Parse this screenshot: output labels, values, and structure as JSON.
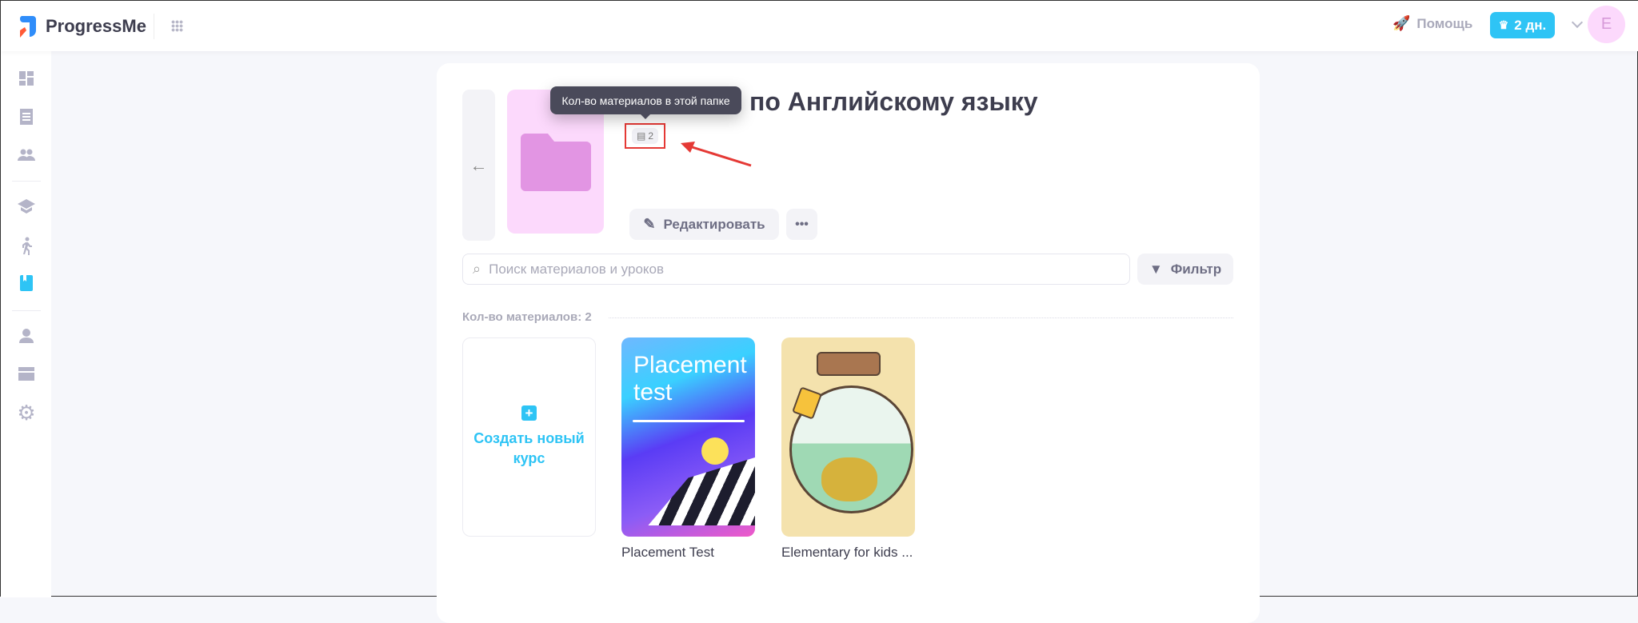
{
  "header": {
    "brand": "ProgressMe",
    "help_label": "Помощь",
    "trial_badge": "2 дн.",
    "avatar_initial": "E",
    "accent": "#2ec4f5"
  },
  "sidebar": {
    "items": [
      "dashboard",
      "materials",
      "groups",
      "courses",
      "activity",
      "library",
      "profile",
      "billing",
      "settings"
    ],
    "active": "library"
  },
  "folder": {
    "title_visible": "по Английскому языку",
    "materials_count": "2",
    "tooltip": "Кол-во материалов в этой папке",
    "edit_label": "Редактировать"
  },
  "search": {
    "placeholder": "Поиск материалов и уроков",
    "filter_label": "Фильтр"
  },
  "materials_count_label": "Кол-во материалов: 2",
  "create_course_label": "Создать новый курс",
  "courses": [
    {
      "title": "Placement Test",
      "cover_text": "Placement test"
    },
    {
      "title": "Elementary for kids ..."
    }
  ]
}
